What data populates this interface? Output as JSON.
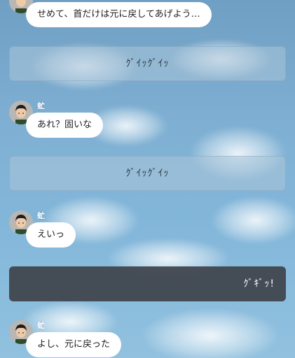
{
  "messages": [
    {
      "sender": "",
      "text": "せめて、首だけは元に戻してあげよう…"
    },
    {
      "sender": "虻",
      "text": "あれ？固いな"
    },
    {
      "sender": "虻",
      "text": "えいっ"
    },
    {
      "sender": "虻",
      "text": "よし、元に戻った"
    }
  ],
  "sound_effects": [
    {
      "text": "ｸﾞｲｯｸﾞｲｯ",
      "style": "light"
    },
    {
      "text": "ｸﾞｲｯｸﾞｲｯ",
      "style": "light"
    },
    {
      "text": "ｸﾞｷﾞｯ!",
      "style": "dark"
    }
  ],
  "icons": {
    "avatar": "character-avatar-icon"
  },
  "colors": {
    "sky": "#7fb0d3",
    "bubble": "#ffffff",
    "sfx_light": "#aac4d8",
    "sfx_dark": "#3e424a"
  }
}
